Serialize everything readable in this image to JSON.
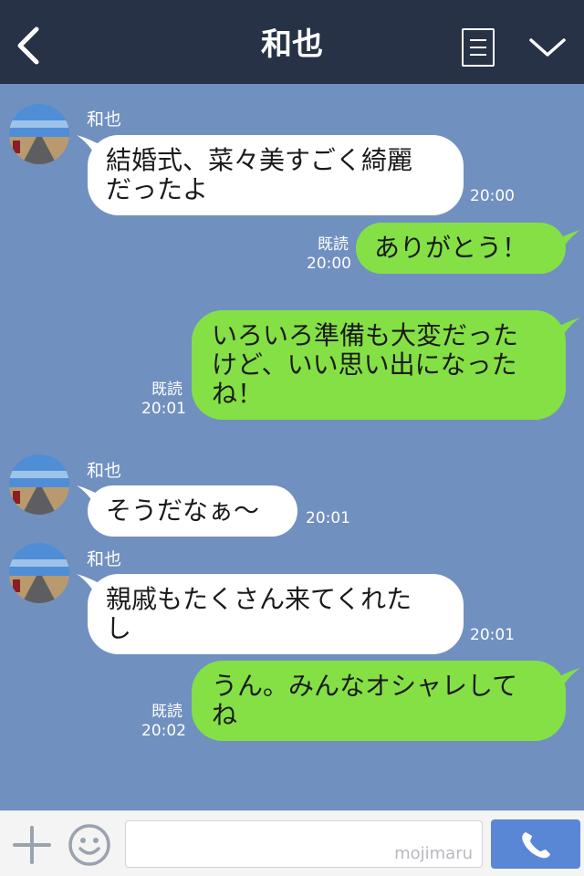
{
  "header": {
    "title": "和也",
    "back_icon": "chevron-left-icon",
    "list_icon": "list-icon",
    "menu_icon": "chevron-down-icon"
  },
  "messages": [
    {
      "side": "in",
      "sender": "和也",
      "text": "結婚式、菜々美すごく綺麗だったよ",
      "line1": "結婚式、菜々美すごく綺麗",
      "line2": "だったよ",
      "time": "20:00"
    },
    {
      "side": "out",
      "read": "既読",
      "text": "ありがとう！",
      "time": "20:00"
    },
    {
      "side": "out",
      "read": "既読",
      "text": "いろいろ準備も大変だったけど、いい思い出になったね！",
      "line1": "いろいろ準備も大変だった",
      "line2": "けど、いい思い出になった",
      "line3": "ね！",
      "time": "20:01"
    },
    {
      "side": "in",
      "sender": "和也",
      "text": "そうだなぁ〜",
      "time": "20:01"
    },
    {
      "side": "in",
      "sender": "和也",
      "text": "親戚もたくさん来てくれたし",
      "line1": "親戚もたくさん来てくれた",
      "line2": "し",
      "time": "20:01"
    },
    {
      "side": "out",
      "read": "既読",
      "text": "うん。みんなオシャレしてね",
      "line1": "うん。みんなオシャレして",
      "line2": "ね",
      "time": "20:02"
    }
  ],
  "footer": {
    "input_value": "",
    "watermark": "mojimaru",
    "plus_icon": "plus-icon",
    "emoji_icon": "smiley-icon",
    "call_icon": "phone-icon"
  },
  "colors": {
    "header_bg": "#283246",
    "chat_bg": "#7090c0",
    "incoming_bubble": "#ffffff",
    "outgoing_bubble": "#84e045",
    "call_button": "#5a86d6"
  }
}
